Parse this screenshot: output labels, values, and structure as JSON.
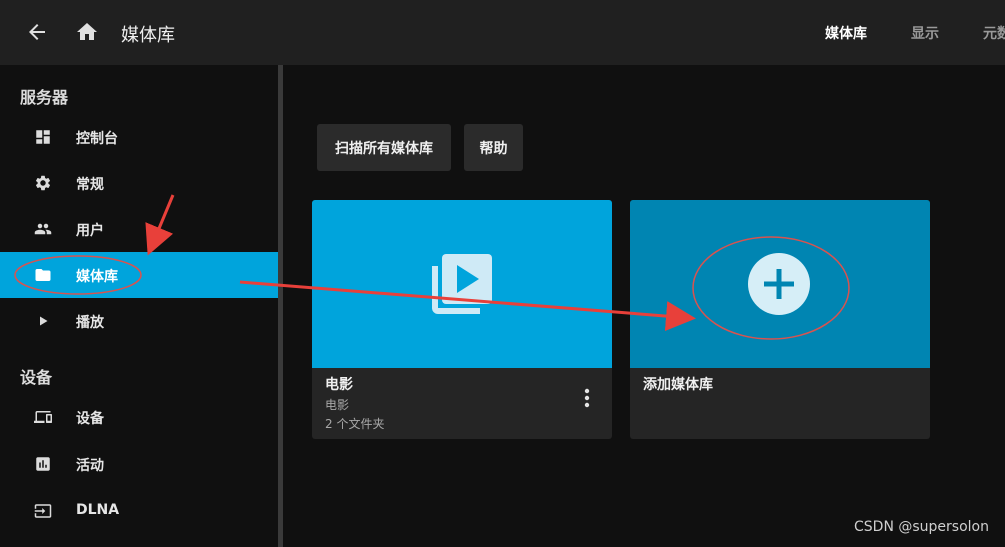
{
  "header": {
    "title": "媒体库",
    "tabs": [
      {
        "label": "媒体库",
        "active": true
      },
      {
        "label": "显示",
        "active": false
      },
      {
        "label": "元数据",
        "active": false
      }
    ]
  },
  "sidebar": {
    "sections": [
      {
        "title": "服务器",
        "items": [
          {
            "label": "控制台",
            "icon": "dashboard-icon"
          },
          {
            "label": "常规",
            "icon": "gear-icon"
          },
          {
            "label": "用户",
            "icon": "users-icon"
          },
          {
            "label": "媒体库",
            "icon": "folder-icon",
            "active": true
          },
          {
            "label": "播放",
            "icon": "play-icon"
          }
        ]
      },
      {
        "title": "设备",
        "items": [
          {
            "label": "设备",
            "icon": "devices-icon"
          },
          {
            "label": "活动",
            "icon": "activity-chart-icon"
          },
          {
            "label": "DLNA",
            "icon": "dlna-input-icon"
          }
        ]
      }
    ]
  },
  "main": {
    "buttons": {
      "scan_all": "扫描所有媒体库",
      "help": "帮助"
    },
    "libraries": [
      {
        "title": "电影",
        "type": "电影",
        "folders": "2 个文件夹",
        "icon": "movie-library-icon"
      }
    ],
    "add_library": {
      "title": "添加媒体库",
      "icon": "plus-icon"
    }
  },
  "watermark": "CSDN @supersolon",
  "colors": {
    "accent": "#00a4dc",
    "card_add": "#0085b2",
    "header_bg": "#202020",
    "page_bg": "#101010",
    "annotation_red": "#e8403a"
  }
}
